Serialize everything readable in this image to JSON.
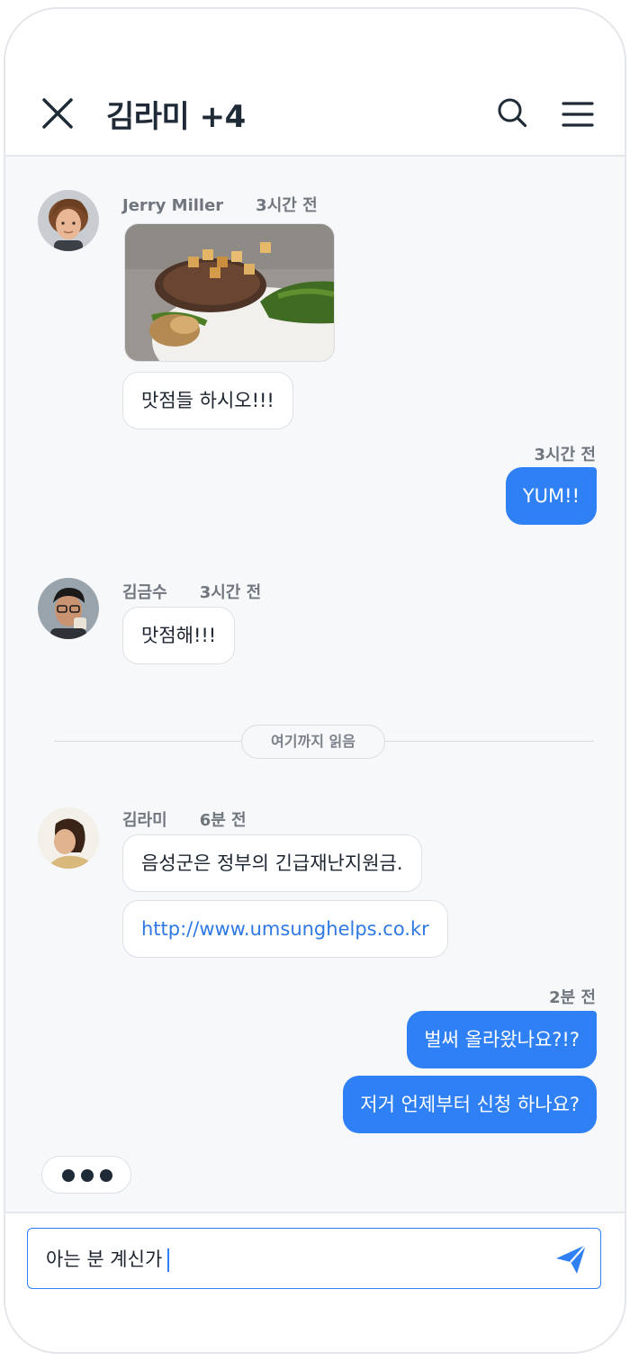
{
  "header": {
    "title": "김라미 +4"
  },
  "messages": {
    "m1": {
      "sender": "Jerry Miller",
      "time": "3시간 전",
      "text": "맛점들 하시오!!!"
    },
    "m2": {
      "time": "3시간 전",
      "text": "YUM!!"
    },
    "m3": {
      "sender": "김금수",
      "time": "3시간 전",
      "text": "맛점해!!!"
    },
    "divider": "여기까지 읽음",
    "m4": {
      "sender": "김라미",
      "time": "6분 전",
      "text": "음성군은 정부의 긴급재난지원금.",
      "link": "http://www.umsunghelps.co.kr"
    },
    "m5": {
      "time": "2분 전",
      "text1": "벌써 올라왔나요?!?",
      "text2": "저거 언제부터 신청 하나요?"
    }
  },
  "composer": {
    "value": "아는 분 계신가"
  },
  "colors": {
    "accent": "#2f80f4",
    "background": "#f6f8fa",
    "incoming_bubble": "#ffffff",
    "text": "#1c2530"
  },
  "icons": {
    "close": "close-icon",
    "search": "search-icon",
    "menu": "hamburger-menu-icon",
    "send": "send-icon"
  }
}
